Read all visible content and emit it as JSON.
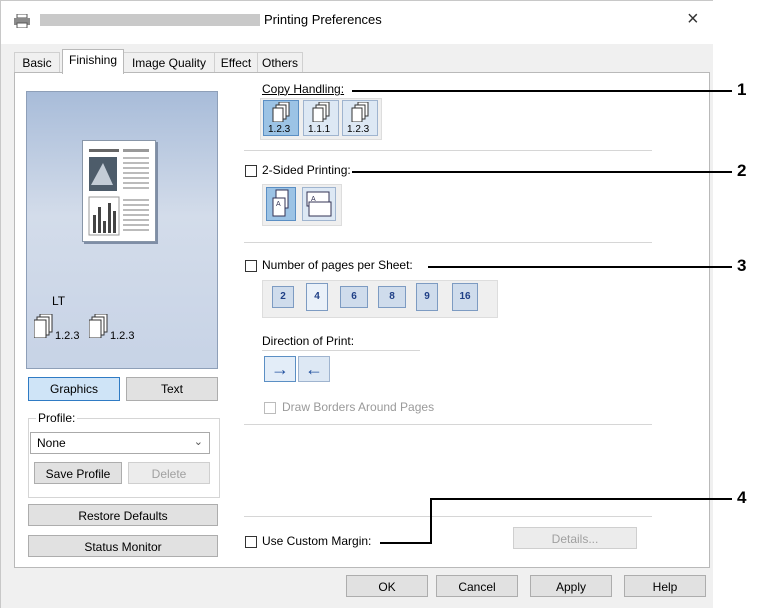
{
  "window": {
    "title": "Printing Preferences",
    "close_glyph": "×"
  },
  "tabs": [
    "Basic",
    "Finishing",
    "Image Quality",
    "Effect",
    "Others"
  ],
  "preview": {
    "paper_label": "LT",
    "order_label_1": "1.2.3",
    "order_label_2": "1.2.3",
    "graphics_button": "Graphics",
    "text_button": "Text"
  },
  "profile": {
    "label": "Profile:",
    "selected": "None",
    "save_button": "Save Profile",
    "delete_button": "Delete"
  },
  "restore_defaults_button": "Restore Defaults",
  "status_monitor_button": "Status Monitor",
  "copy_handling": {
    "label": "Copy Handling:",
    "options": [
      "1.2.3",
      "1.1.1",
      "1.2.3"
    ]
  },
  "two_sided": {
    "label": "2-Sided Printing:",
    "checked": false
  },
  "pages_per_sheet": {
    "label": "Number of pages per Sheet:",
    "checked": false,
    "options": [
      "2",
      "4",
      "6",
      "8",
      "9",
      "16"
    ]
  },
  "direction_of_print": {
    "label": "Direction of Print:",
    "options": [
      "→",
      "←"
    ]
  },
  "draw_borders": {
    "label": "Draw Borders Around Pages",
    "checked": false
  },
  "custom_margin": {
    "label": "Use Custom Margin:",
    "checked": false,
    "details_button": "Details..."
  },
  "footer": {
    "ok": "OK",
    "cancel": "Cancel",
    "apply": "Apply",
    "help": "Help"
  },
  "callouts": [
    "1",
    "2",
    "3",
    "4"
  ]
}
